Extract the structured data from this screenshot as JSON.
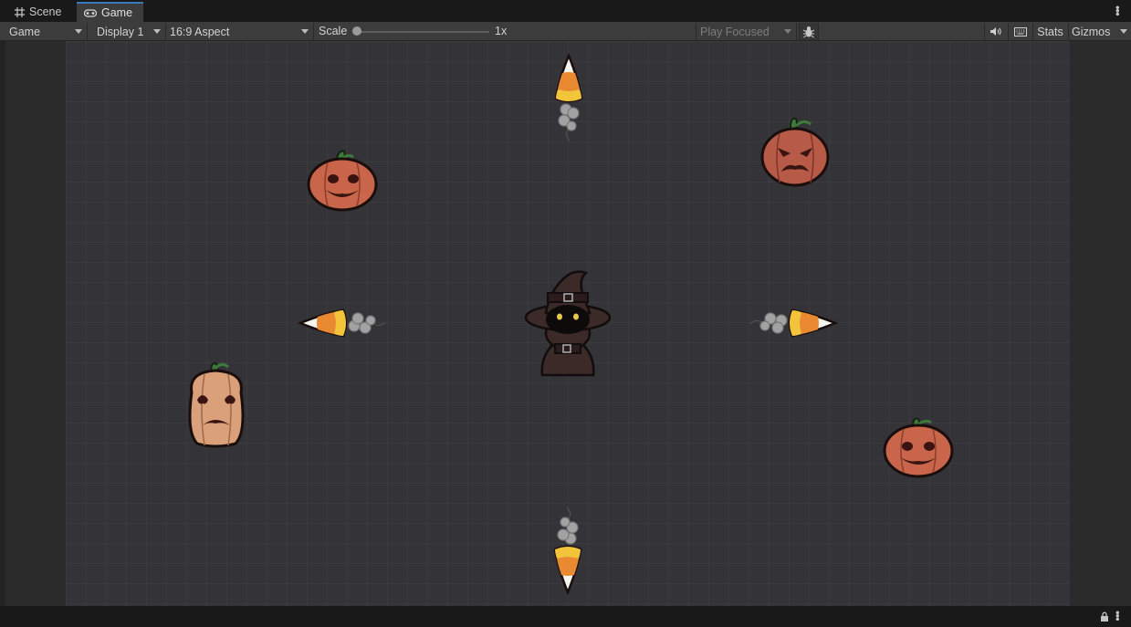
{
  "tabs": [
    {
      "label": "Scene",
      "icon": "grid-icon",
      "active": false
    },
    {
      "label": "Game",
      "icon": "gamepad-icon",
      "active": true
    }
  ],
  "toolbar": {
    "view_mode": "Game",
    "display": "Display 1",
    "aspect": "16:9 Aspect",
    "scale_label": "Scale",
    "scale_value": "1x",
    "scale_fraction": 0,
    "play_mode": "Play Focused",
    "stats_label": "Stats",
    "gizmos_label": "Gizmos"
  },
  "scene": {
    "background_color": "#333338",
    "sprites": [
      "witch",
      "jack-o-lantern",
      "jack-o-lantern",
      "jack-o-lantern",
      "sad-pumpkin",
      "candy-corn-projectile",
      "candy-corn-projectile",
      "candy-corn-projectile",
      "candy-corn-projectile"
    ]
  },
  "colors": {
    "active_tab_accent": "#3a79bb",
    "toolbar": "#3c3c3c",
    "pumpkin": "#c8654a",
    "pale_pumpkin": "#d9a07a"
  }
}
